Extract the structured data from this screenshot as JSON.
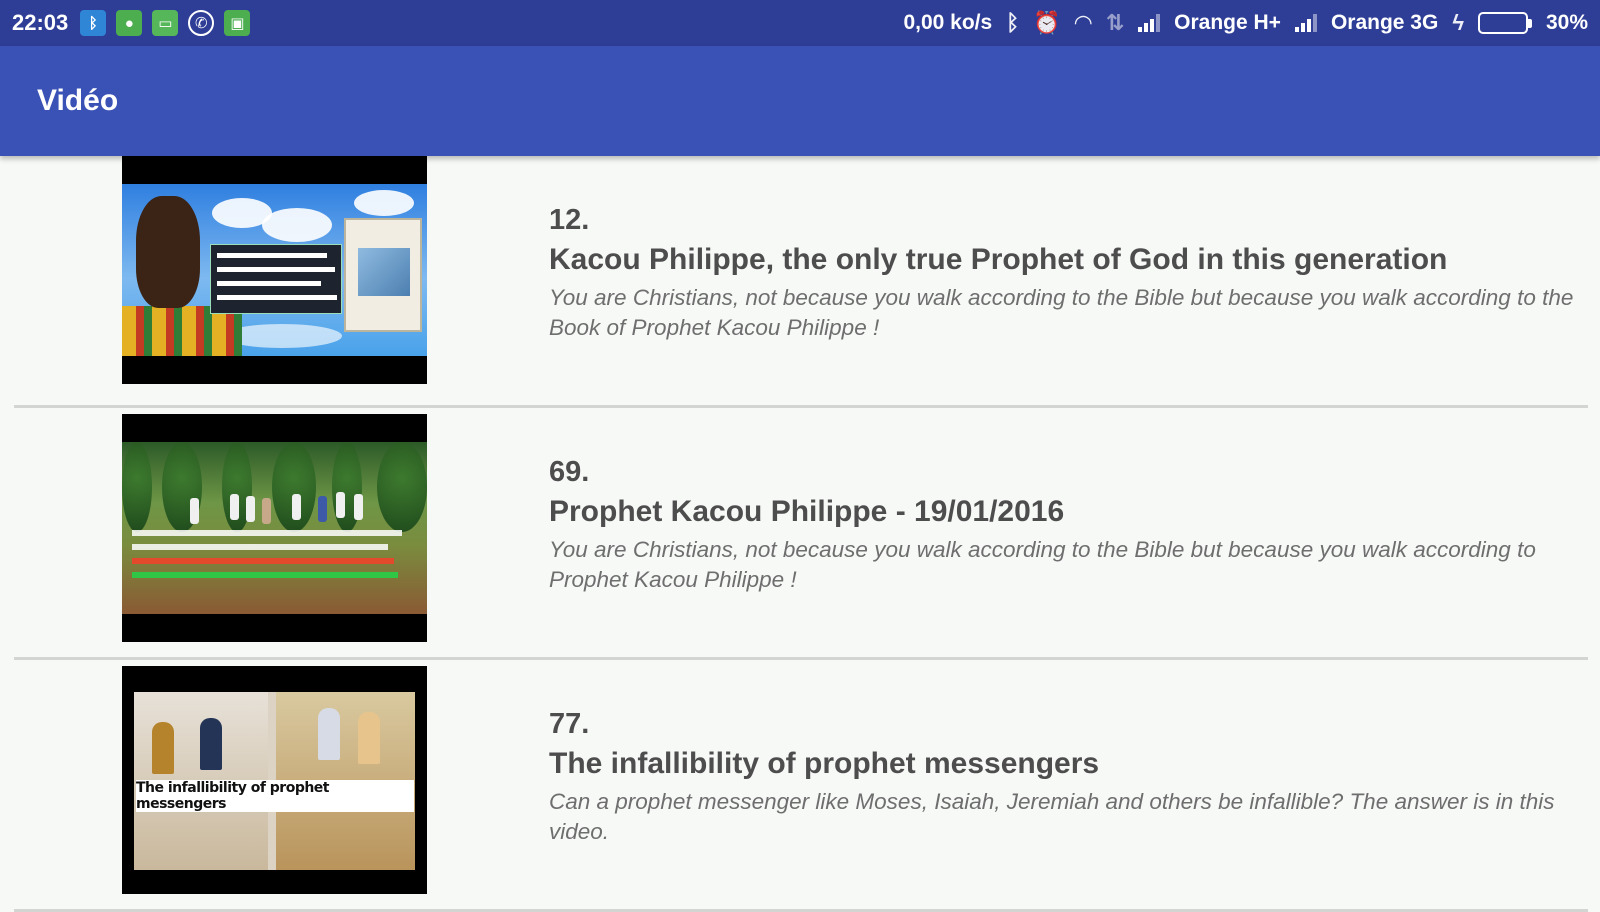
{
  "status_bar": {
    "time": "22:03",
    "net_speed": "0,00 ko/s",
    "carrier1": "Orange H+",
    "carrier2": "Orange 3G",
    "battery": "30%",
    "battery_level": 0.3,
    "notification_icons": [
      "bluetooth-icon",
      "app-icon",
      "message-icon",
      "whatsapp-icon",
      "app-icon"
    ],
    "status_icons": [
      "bluetooth-icon",
      "alarm-icon",
      "wifi-icon",
      "data-transfer-icon",
      "signal-icon",
      "charging-icon"
    ]
  },
  "app_bar": {
    "title": "Vidéo"
  },
  "videos": [
    {
      "number": "12.",
      "title": "Kacou Philippe, the only true Prophet of God in this generation",
      "description": "You are Christians, not because you walk according to the Bible but because you walk according to the Book of Prophet Kacou Philippe !"
    },
    {
      "number": "69.",
      "title": "Prophet Kacou Philippe - 19/01/2016",
      "description": "You are Christians, not because you walk according to the Bible but because you walk according to Prophet Kacou Philippe !"
    },
    {
      "number": "77.",
      "title": "The infallibility of prophet messengers",
      "description": "Can a prophet messenger like Moses, Isaiah, Jeremiah and others be infallible? The answer is in this video.",
      "thumbnail_caption": "The infallibility of prophet messengers"
    }
  ],
  "colors": {
    "status_bar": "#2e3e96",
    "app_bar": "#3a52b5",
    "background": "#f7f9f7"
  }
}
